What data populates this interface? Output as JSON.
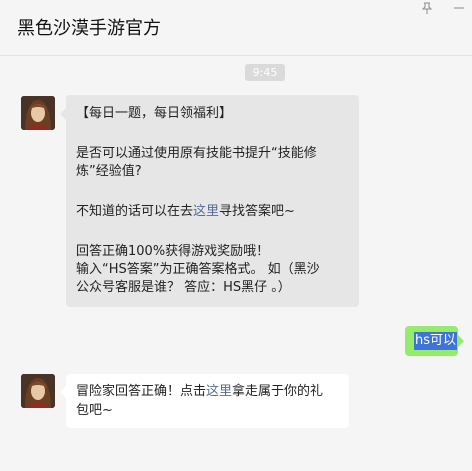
{
  "header": {
    "title": "黑色沙漠手游官方",
    "pin_icon": "pin-icon",
    "minimize_icon": "minimize-icon"
  },
  "timestamp": "9:45",
  "messages": [
    {
      "sender": "official-account",
      "lines": [
        {
          "text": "【每日一题，每日领福利】"
        },
        {
          "text": "是否可以通过使用原有技能书提升“技能修"
        },
        {
          "text": "炼”经验值?"
        },
        {
          "pre": "不知道的话可以在去",
          "link": "这里",
          "post": "寻找答案吧~"
        },
        {
          "text": "回答正确100%获得游戏奖励哦！"
        },
        {
          "text": "输入“HS答案”为正确答案格式。 如（黑沙"
        },
        {
          "text": "公众号客服是谁？ 答应：HS黑仔 。）"
        }
      ]
    },
    {
      "sender": "me",
      "text": "hs可以"
    },
    {
      "sender": "official-account",
      "lines": [
        {
          "pre": "冒险家回答正确！点击",
          "link": "这里",
          "post": "拿走属于你的礼"
        },
        {
          "text": "包吧~"
        }
      ]
    }
  ],
  "colors": {
    "outgoing_bubble": "#95ec69",
    "link": "#576b95",
    "selection": "#3f74d6"
  }
}
